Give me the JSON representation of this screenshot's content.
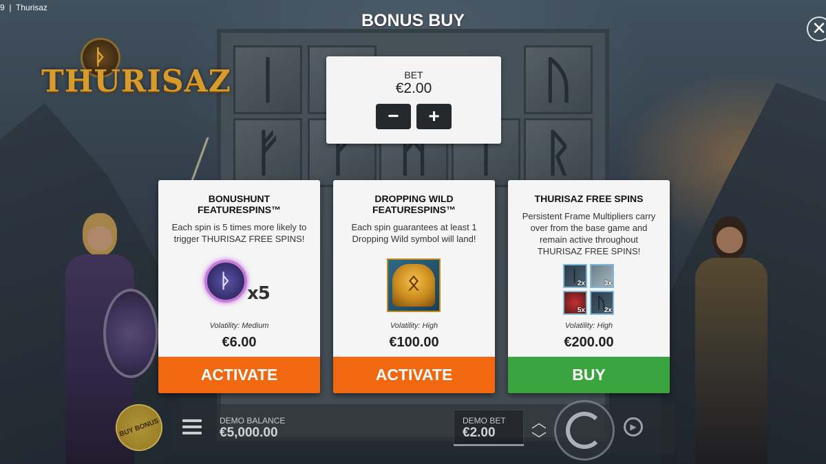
{
  "window": {
    "title": "9  |  Thurisaz"
  },
  "logo": {
    "text": "THURISAZ",
    "rune": "ᚦ"
  },
  "modal": {
    "title": "BONUS BUY",
    "close_glyph": "✕"
  },
  "bet_panel": {
    "label": "BET",
    "value": "€2.00",
    "decrease_glyph": "−",
    "increase_glyph": "+"
  },
  "cards": [
    {
      "title": "BONUSHUNT FEATURESPINS™",
      "description": "Each spin is 5 times more likely to trigger THURISAZ FREE SPINS!",
      "art_rune": "ᚦ",
      "art_multiplier": "x5",
      "volatility": "Volatility: Medium",
      "price": "€6.00",
      "action": "ACTIVATE",
      "action_color": "#f26811"
    },
    {
      "title": "DROPPING WILD FEATURESPINS™",
      "description": "Each spin guarantees at least 1 Dropping Wild symbol will land!",
      "art_rune": "ᛟ",
      "volatility": "Volatility: High",
      "price": "€100.00",
      "action": "ACTIVATE",
      "action_color": "#f26811"
    },
    {
      "title": "THURISAZ FREE SPINS",
      "description": "Persistent Frame Multipliers carry over from the base game and remain active throughout THURISAZ FREE SPINS!",
      "art_multipliers": [
        "2x",
        "3x",
        "5x",
        "2x"
      ],
      "art_runes": [
        "ᛁ",
        "ᚢ"
      ],
      "volatility": "Volatility: High",
      "price": "€200.00",
      "action": "BUY",
      "action_color": "#3aa53f"
    }
  ],
  "bottom_bar": {
    "buy_bonus_label": "BUY BONUS",
    "demo_balance_label": "DEMO BALANCE",
    "demo_balance_value": "€5,000.00",
    "demo_bet_label": "DEMO BET",
    "demo_bet_value": "€2.00",
    "up_glyph": "︿",
    "down_glyph": "﹀",
    "autoplay_glyph": "▶"
  },
  "background_runes": [
    "ᛁ",
    "ᛁ",
    "ᚢ",
    "ᚠ",
    "ᚠ",
    "ᛗ",
    "ᛉ",
    "ᚱ"
  ]
}
